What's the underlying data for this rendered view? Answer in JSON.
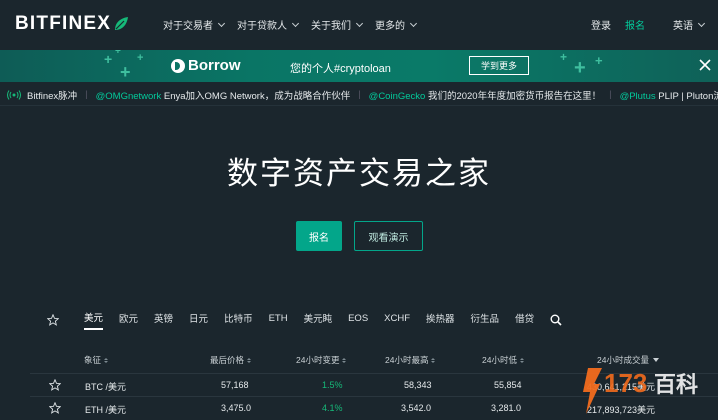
{
  "nav": {
    "logo": "BITFINEX",
    "menu": [
      "对于交易者",
      "对于贷款人",
      "关于我们",
      "更多的"
    ],
    "login": "登录",
    "signup": "报名",
    "language": "英语"
  },
  "banner": {
    "product": "Borrow",
    "text": "您的个人#cryptoloan",
    "button": "学到更多"
  },
  "ticker": {
    "label": "Bitfinex脉冲",
    "items": [
      {
        "mention": "@OMGnetwork",
        "text": " Enya加入OMG Network，成为战略合作伙伴"
      },
      {
        "mention": "@CoinGecko",
        "text": " 我们的2020年年度加密货币报告在这里！"
      },
      {
        "mention": "@Plutus",
        "text": " PLIP | Pluton流动"
      }
    ]
  },
  "hero": {
    "title": "数字资产交易之家",
    "signup_button": "报名",
    "demo_button": "观看演示"
  },
  "tabs": [
    "美元",
    "欧元",
    "英镑",
    "日元",
    "比特币",
    "ETH",
    "美元盹",
    "EOS",
    "XCHF",
    "挨热器",
    "衍生品",
    "借贷"
  ],
  "active_tab": "美元",
  "table": {
    "headers": [
      "象征",
      "最后价格",
      "24小时变更",
      "24小时最高",
      "24小时低",
      "24小时成交量"
    ],
    "rows": [
      {
        "symbol": "BTC /美元",
        "last": "57,168",
        "change": "1.5%",
        "high": "58,343",
        "low": "55,854",
        "volume": "430,641,215美元"
      },
      {
        "symbol": "ETH /美元",
        "last": "3,475.0",
        "change": "4.1%",
        "high": "3,542.0",
        "low": "3,281.0",
        "volume": "217,893,723美元"
      }
    ]
  },
  "watermark": {
    "number": "173",
    "text": "百科"
  },
  "colors": {
    "accent": "#03ca9b",
    "background": "#1b262d",
    "banner": "#0a7565",
    "positive": "#16b979"
  }
}
